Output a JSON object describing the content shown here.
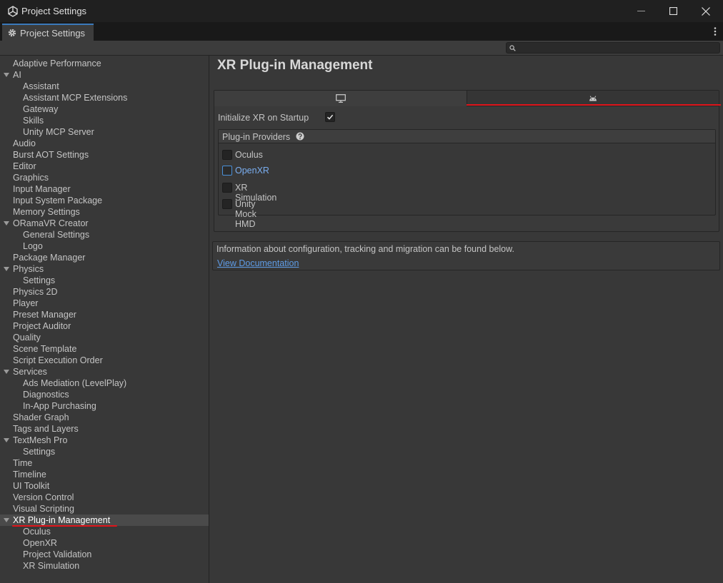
{
  "window": {
    "title": "Project Settings",
    "icon": "unity-logo-icon"
  },
  "tab": {
    "label": "Project Settings",
    "icon": "gear-icon"
  },
  "search": {
    "value": "",
    "placeholder": ""
  },
  "sidebar": {
    "items": [
      {
        "label": "Adaptive Performance",
        "level": 0,
        "foldout": false
      },
      {
        "label": "AI",
        "level": 0,
        "foldout": true
      },
      {
        "label": "Assistant",
        "level": 1
      },
      {
        "label": "Assistant MCP Extensions",
        "level": 1
      },
      {
        "label": "Gateway",
        "level": 1
      },
      {
        "label": "Skills",
        "level": 1
      },
      {
        "label": "Unity MCP Server",
        "level": 1
      },
      {
        "label": "Audio",
        "level": 0
      },
      {
        "label": "Burst AOT Settings",
        "level": 0
      },
      {
        "label": "Editor",
        "level": 0
      },
      {
        "label": "Graphics",
        "level": 0
      },
      {
        "label": "Input Manager",
        "level": 0
      },
      {
        "label": "Input System Package",
        "level": 0
      },
      {
        "label": "Memory Settings",
        "level": 0
      },
      {
        "label": "ORamaVR Creator",
        "level": 0,
        "foldout": true
      },
      {
        "label": "General Settings",
        "level": 1
      },
      {
        "label": "Logo",
        "level": 1
      },
      {
        "label": "Package Manager",
        "level": 0
      },
      {
        "label": "Physics",
        "level": 0,
        "foldout": true
      },
      {
        "label": "Settings",
        "level": 1
      },
      {
        "label": "Physics 2D",
        "level": 0
      },
      {
        "label": "Player",
        "level": 0
      },
      {
        "label": "Preset Manager",
        "level": 0
      },
      {
        "label": "Project Auditor",
        "level": 0
      },
      {
        "label": "Quality",
        "level": 0
      },
      {
        "label": "Scene Template",
        "level": 0
      },
      {
        "label": "Script Execution Order",
        "level": 0
      },
      {
        "label": "Services",
        "level": 0,
        "foldout": true
      },
      {
        "label": "Ads Mediation (LevelPlay)",
        "level": 1
      },
      {
        "label": "Diagnostics",
        "level": 1
      },
      {
        "label": "In-App Purchasing",
        "level": 1
      },
      {
        "label": "Shader Graph",
        "level": 0
      },
      {
        "label": "Tags and Layers",
        "level": 0
      },
      {
        "label": "TextMesh Pro",
        "level": 0,
        "foldout": true
      },
      {
        "label": "Settings",
        "level": 1
      },
      {
        "label": "Time",
        "level": 0
      },
      {
        "label": "Timeline",
        "level": 0
      },
      {
        "label": "UI Toolkit",
        "level": 0
      },
      {
        "label": "Version Control",
        "level": 0
      },
      {
        "label": "Visual Scripting",
        "level": 0
      },
      {
        "label": "XR Plug-in Management",
        "level": 0,
        "foldout": true,
        "selected": true
      },
      {
        "label": "Oculus",
        "level": 1
      },
      {
        "label": "OpenXR",
        "level": 1
      },
      {
        "label": "Project Validation",
        "level": 1
      },
      {
        "label": "XR Simulation",
        "level": 1
      }
    ]
  },
  "main": {
    "title": "XR Plug-in Management",
    "platform_tabs": [
      {
        "icon": "desktop-monitor-icon",
        "active": true
      },
      {
        "icon": "android-icon",
        "active": false
      }
    ],
    "init_on_startup": {
      "label": "Initialize XR on Startup",
      "checked": true
    },
    "providers": {
      "header": "Plug-in Providers",
      "items": [
        {
          "label": "Oculus",
          "checked": false
        },
        {
          "label": "OpenXR",
          "checked": false
        },
        {
          "label": "XR Simulation",
          "checked": false
        },
        {
          "label": "Unity Mock HMD",
          "checked": false
        }
      ]
    },
    "info": {
      "text": "Information about configuration, tracking and migration can be found below.",
      "link": "View Documentation"
    }
  },
  "colors": {
    "accent_blue": "#3a79bb",
    "highlight_red": "#e0141a",
    "link_blue": "#5e9ce6"
  }
}
